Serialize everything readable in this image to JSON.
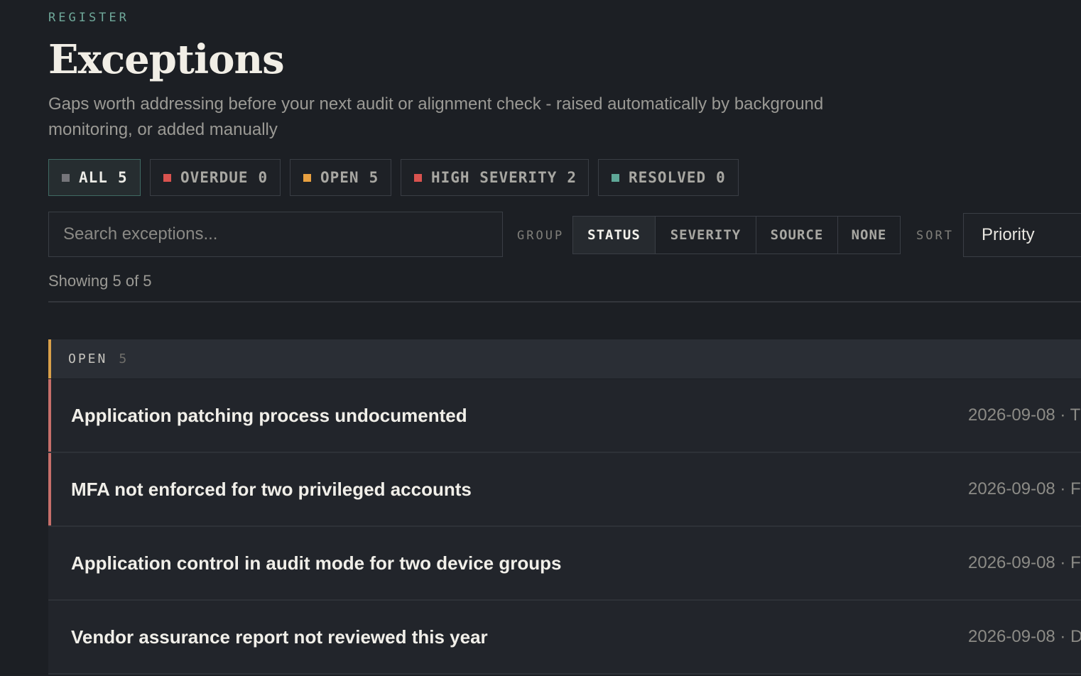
{
  "header": {
    "eyebrow": "REGISTER",
    "title": "Exceptions",
    "subtitle": "Gaps worth addressing before your next audit or alignment check - raised automatically by background monitoring, or added manually"
  },
  "filters": [
    {
      "label": "ALL",
      "count": "5",
      "color": "#75757a",
      "active": true
    },
    {
      "label": "OVERDUE",
      "count": "0",
      "color": "#d9534f",
      "active": false
    },
    {
      "label": "OPEN",
      "count": "5",
      "color": "#e8a040",
      "active": false
    },
    {
      "label": "HIGH SEVERITY",
      "count": "2",
      "color": "#d9534f",
      "active": false
    },
    {
      "label": "RESOLVED",
      "count": "0",
      "color": "#5fa898",
      "active": false
    }
  ],
  "search": {
    "placeholder": "Search exceptions..."
  },
  "group_by": {
    "label": "GROUP",
    "options": [
      "STATUS",
      "SEVERITY",
      "SOURCE",
      "NONE"
    ],
    "selected": "STATUS"
  },
  "sort": {
    "label": "SORT",
    "value": "Priority"
  },
  "results": {
    "showing": "Showing 5 of 5"
  },
  "group": {
    "name": "OPEN",
    "count": "5",
    "accent": "#d9a04a"
  },
  "rows": [
    {
      "title": "Application patching process undocumented",
      "meta": "2026-09-08 · T",
      "accent": "#c76f6a"
    },
    {
      "title": "MFA not enforced for two privileged accounts",
      "meta": "2026-09-08 · F",
      "accent": "#c76f6a"
    },
    {
      "title": "Application control in audit mode for two device groups",
      "meta": "2026-09-08 · F",
      "accent": ""
    },
    {
      "title": "Vendor assurance report not reviewed this year",
      "meta": "2026-09-08 · D",
      "accent": ""
    }
  ]
}
